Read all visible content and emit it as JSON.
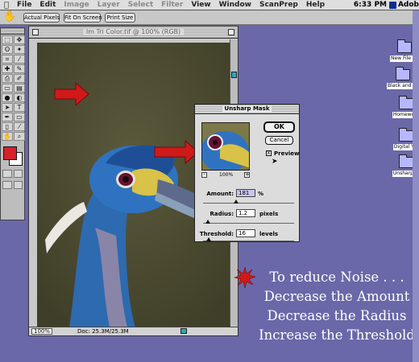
{
  "menubar": {
    "apple_icon": "apple-logo",
    "items": [
      "File",
      "Edit",
      "Image",
      "Layer",
      "Select",
      "Filter",
      "View",
      "Window",
      "ScanPrep",
      "Help"
    ],
    "dim_items": [
      "Image",
      "Layer",
      "Select",
      "Filter"
    ],
    "clock": "6:33 PM",
    "app_name": "Adob"
  },
  "options_bar": {
    "tool_icon": "hand-icon",
    "buttons": [
      "Actual Pixels",
      "Fit On Screen",
      "Print Size"
    ]
  },
  "toolbox": {
    "tools": [
      "marquee-icon",
      "move-icon",
      "lasso-icon",
      "magic-wand-icon",
      "crop-icon",
      "slice-icon",
      "healing-icon",
      "brush-icon",
      "stamp-icon",
      "history-brush-icon",
      "eraser-icon",
      "gradient-icon",
      "blur-icon",
      "dodge-icon",
      "path-select-icon",
      "type-icon",
      "pen-icon",
      "shape-icon",
      "notes-icon",
      "eyedropper-icon",
      "hand-icon",
      "zoom-icon"
    ],
    "tool_glyphs": [
      "⬚",
      "✥",
      "ʘ",
      "✦",
      "⌗",
      "⁄",
      "✚",
      "✎",
      "⎙",
      "✐",
      "▭",
      "▤",
      "●",
      "◐",
      "➤",
      "T",
      "✒",
      "▭",
      "▯",
      "⁄",
      "✋",
      "⌕"
    ],
    "foreground_color": "#d5202a",
    "background_color": "#ffffff"
  },
  "document": {
    "title": "Im Tri Color.tif @ 100% (RGB)",
    "zoom": "100%",
    "doc_size": "Doc: 25.3M/25.3M"
  },
  "dialog": {
    "title": "Unsharp Mask",
    "ok_label": "OK",
    "cancel_label": "Cancel",
    "preview_label": "Preview",
    "preview_checked": "x",
    "preview_zoom": "100%",
    "zoom_out": "-",
    "zoom_in": "+",
    "amount_label": "Amount:",
    "amount_value": "181",
    "amount_unit": "%",
    "amount_fraction": 0.36,
    "radius_label": "Radius:",
    "radius_value": "1.2",
    "radius_unit": "pixels",
    "radius_fraction": 0.05,
    "threshold_label": "Threshold:",
    "threshold_value": "16",
    "threshold_unit": "levels",
    "threshold_fraction": 0.06
  },
  "desktop_icons": [
    "New File Sc",
    "Black and Whit",
    "Homework",
    "Digital Yat",
    "Unsharp M"
  ],
  "caption": {
    "line1": "To reduce Noise . . .",
    "line2": "Decrease the Amount",
    "line3": "Decrease the Radius",
    "line4": "Increase the Threshold",
    "icon": "starburst-icon"
  },
  "colors": {
    "desktop": "#6a68a8",
    "arrow": "#d01a1a",
    "scroll_thumb": "#2aa8b8"
  }
}
